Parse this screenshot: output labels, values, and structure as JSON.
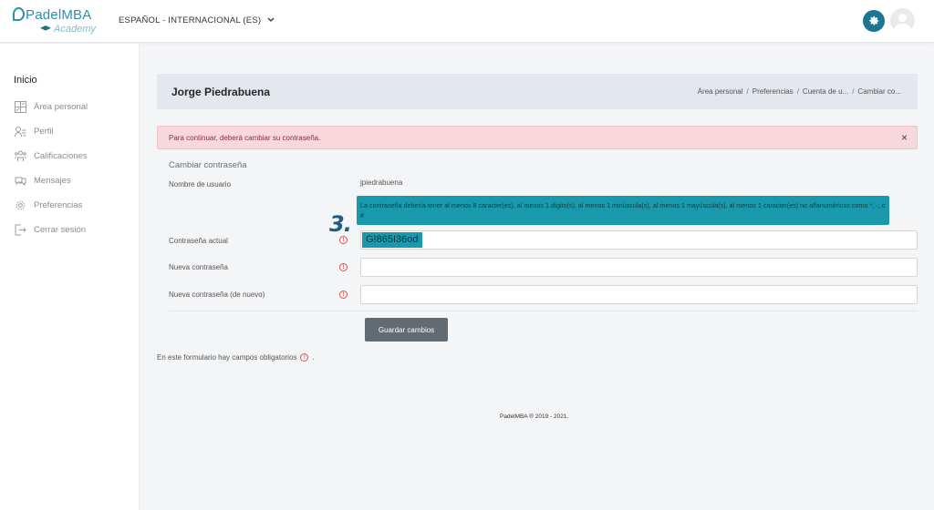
{
  "navbar": {
    "logo": {
      "brand": "PadelMBA",
      "sub": "Academy"
    },
    "language": "ESPAÑOL - INTERNACIONAL (ES)",
    "icons": {
      "settings": "gear-icon",
      "user": "user-avatar-icon",
      "language_caret": "chevron-down-icon"
    },
    "accent_color": "#1d7591"
  },
  "sidebar": {
    "title": "Inicio",
    "items": [
      {
        "label": "Área personal",
        "icon": "dashboard-icon"
      },
      {
        "label": "Perfil",
        "icon": "profile-icon"
      },
      {
        "label": "Calificaciones",
        "icon": "grades-icon"
      },
      {
        "label": "Mensajes",
        "icon": "messages-icon"
      },
      {
        "label": "Preferencias",
        "icon": "settings-icon"
      },
      {
        "label": "Cerrar sesión",
        "icon": "logout-icon"
      }
    ]
  },
  "header": {
    "name": "Jorge Piedrabuena",
    "breadcrumb": [
      "Área personal",
      "Preferencias",
      "Cuenta de u...",
      "Cambiar co..."
    ]
  },
  "alert": {
    "message": "Para continuar, deberá cambiar su contraseña.",
    "close": "×",
    "bg_color": "#f8d8dc"
  },
  "form": {
    "title": "Cambiar contraseña",
    "username_label": "Nombre de usuario",
    "username_value": "jpiedrabuena",
    "policy_hint": "La contraseña debería tener al menos 8 caracter(es), al menos 1 dígito(s), al menos 1 minúscula(s), al menos 1 mayúscula(s), al menos 1 caracter(es) no alfanuméricos como *, -, o #",
    "step_marker": "3.",
    "current_label": "Contraseña actual",
    "current_value": "G!865I36od",
    "new_label": "Nueva contraseña",
    "new_value": "",
    "repeat_label": "Nueva contraseña (de nuevo)",
    "repeat_value": "",
    "required_icon": "!",
    "save_label": "Guardar cambios",
    "required_note": "En este formulario hay campos obligatorios",
    "required_note_end": ".",
    "highlight_color": "#1a99ac"
  },
  "footer": {
    "text": "PadelMBA ® 2019 - 2021."
  }
}
